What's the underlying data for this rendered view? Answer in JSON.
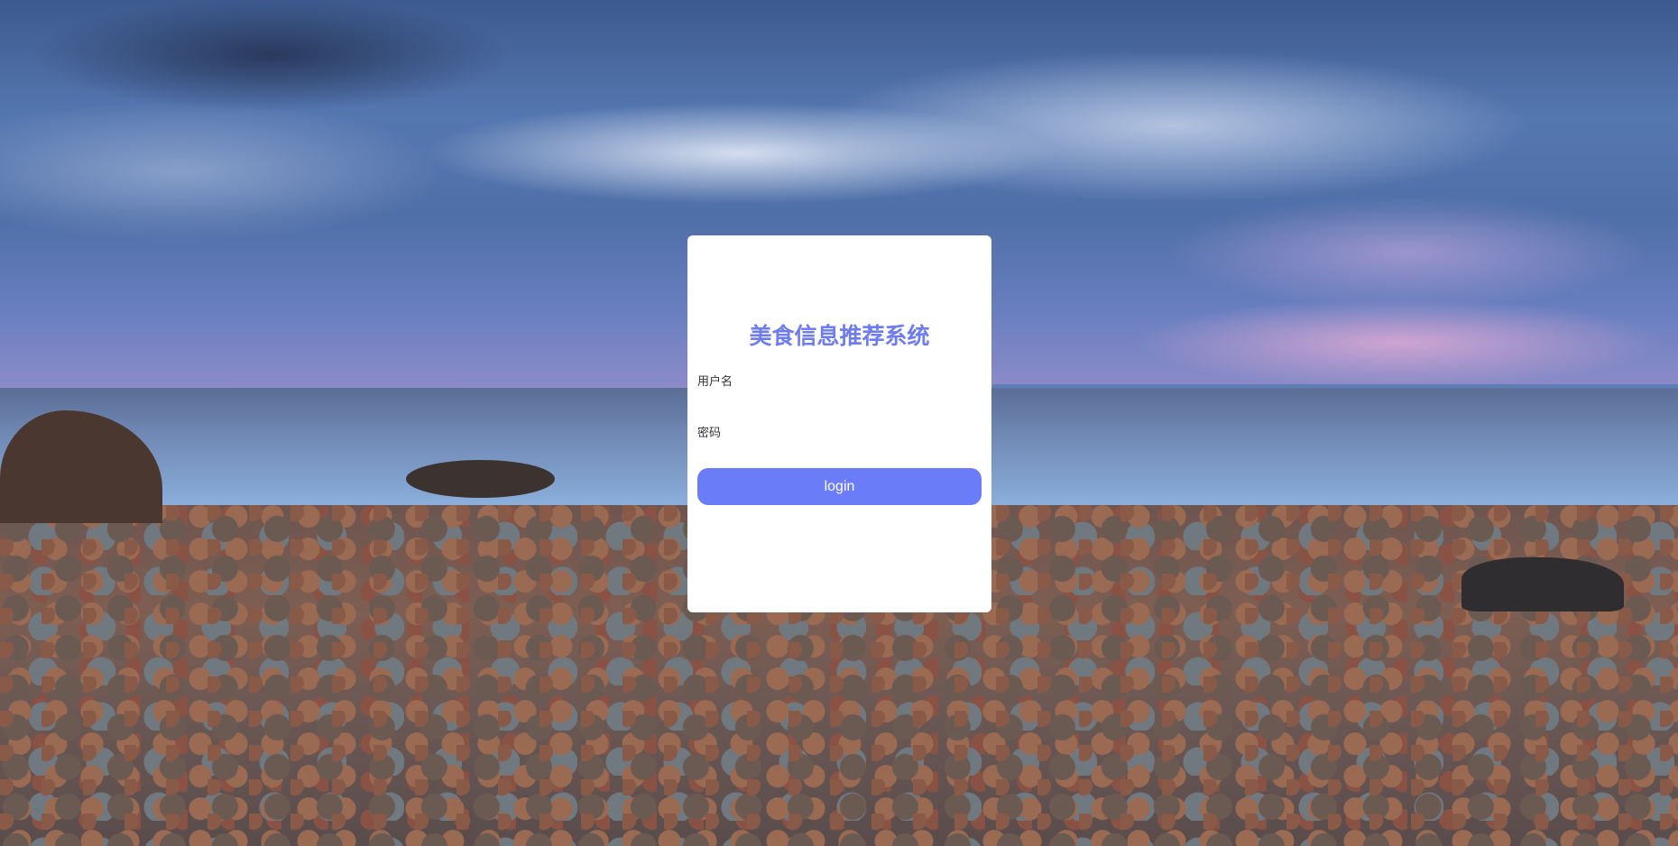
{
  "login": {
    "title": "美食信息推荐系统",
    "username_label": "用户名",
    "username_value": "",
    "password_label": "密码",
    "password_value": "",
    "button_label": "login"
  },
  "colors": {
    "title": "#6e7cf0",
    "button": "#6a7cf8",
    "card": "#ffffff"
  }
}
